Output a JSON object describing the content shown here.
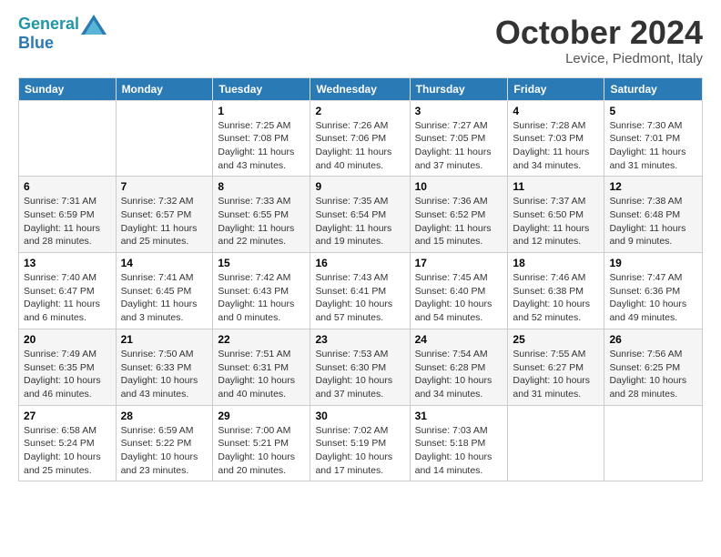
{
  "header": {
    "logo_line1": "General",
    "logo_line2": "Blue",
    "title": "October 2024",
    "location": "Levice, Piedmont, Italy"
  },
  "days_of_week": [
    "Sunday",
    "Monday",
    "Tuesday",
    "Wednesday",
    "Thursday",
    "Friday",
    "Saturday"
  ],
  "weeks": [
    [
      {
        "day": "",
        "info": ""
      },
      {
        "day": "",
        "info": ""
      },
      {
        "day": "1",
        "info": "Sunrise: 7:25 AM\nSunset: 7:08 PM\nDaylight: 11 hours and 43 minutes."
      },
      {
        "day": "2",
        "info": "Sunrise: 7:26 AM\nSunset: 7:06 PM\nDaylight: 11 hours and 40 minutes."
      },
      {
        "day": "3",
        "info": "Sunrise: 7:27 AM\nSunset: 7:05 PM\nDaylight: 11 hours and 37 minutes."
      },
      {
        "day": "4",
        "info": "Sunrise: 7:28 AM\nSunset: 7:03 PM\nDaylight: 11 hours and 34 minutes."
      },
      {
        "day": "5",
        "info": "Sunrise: 7:30 AM\nSunset: 7:01 PM\nDaylight: 11 hours and 31 minutes."
      }
    ],
    [
      {
        "day": "6",
        "info": "Sunrise: 7:31 AM\nSunset: 6:59 PM\nDaylight: 11 hours and 28 minutes."
      },
      {
        "day": "7",
        "info": "Sunrise: 7:32 AM\nSunset: 6:57 PM\nDaylight: 11 hours and 25 minutes."
      },
      {
        "day": "8",
        "info": "Sunrise: 7:33 AM\nSunset: 6:55 PM\nDaylight: 11 hours and 22 minutes."
      },
      {
        "day": "9",
        "info": "Sunrise: 7:35 AM\nSunset: 6:54 PM\nDaylight: 11 hours and 19 minutes."
      },
      {
        "day": "10",
        "info": "Sunrise: 7:36 AM\nSunset: 6:52 PM\nDaylight: 11 hours and 15 minutes."
      },
      {
        "day": "11",
        "info": "Sunrise: 7:37 AM\nSunset: 6:50 PM\nDaylight: 11 hours and 12 minutes."
      },
      {
        "day": "12",
        "info": "Sunrise: 7:38 AM\nSunset: 6:48 PM\nDaylight: 11 hours and 9 minutes."
      }
    ],
    [
      {
        "day": "13",
        "info": "Sunrise: 7:40 AM\nSunset: 6:47 PM\nDaylight: 11 hours and 6 minutes."
      },
      {
        "day": "14",
        "info": "Sunrise: 7:41 AM\nSunset: 6:45 PM\nDaylight: 11 hours and 3 minutes."
      },
      {
        "day": "15",
        "info": "Sunrise: 7:42 AM\nSunset: 6:43 PM\nDaylight: 11 hours and 0 minutes."
      },
      {
        "day": "16",
        "info": "Sunrise: 7:43 AM\nSunset: 6:41 PM\nDaylight: 10 hours and 57 minutes."
      },
      {
        "day": "17",
        "info": "Sunrise: 7:45 AM\nSunset: 6:40 PM\nDaylight: 10 hours and 54 minutes."
      },
      {
        "day": "18",
        "info": "Sunrise: 7:46 AM\nSunset: 6:38 PM\nDaylight: 10 hours and 52 minutes."
      },
      {
        "day": "19",
        "info": "Sunrise: 7:47 AM\nSunset: 6:36 PM\nDaylight: 10 hours and 49 minutes."
      }
    ],
    [
      {
        "day": "20",
        "info": "Sunrise: 7:49 AM\nSunset: 6:35 PM\nDaylight: 10 hours and 46 minutes."
      },
      {
        "day": "21",
        "info": "Sunrise: 7:50 AM\nSunset: 6:33 PM\nDaylight: 10 hours and 43 minutes."
      },
      {
        "day": "22",
        "info": "Sunrise: 7:51 AM\nSunset: 6:31 PM\nDaylight: 10 hours and 40 minutes."
      },
      {
        "day": "23",
        "info": "Sunrise: 7:53 AM\nSunset: 6:30 PM\nDaylight: 10 hours and 37 minutes."
      },
      {
        "day": "24",
        "info": "Sunrise: 7:54 AM\nSunset: 6:28 PM\nDaylight: 10 hours and 34 minutes."
      },
      {
        "day": "25",
        "info": "Sunrise: 7:55 AM\nSunset: 6:27 PM\nDaylight: 10 hours and 31 minutes."
      },
      {
        "day": "26",
        "info": "Sunrise: 7:56 AM\nSunset: 6:25 PM\nDaylight: 10 hours and 28 minutes."
      }
    ],
    [
      {
        "day": "27",
        "info": "Sunrise: 6:58 AM\nSunset: 5:24 PM\nDaylight: 10 hours and 25 minutes."
      },
      {
        "day": "28",
        "info": "Sunrise: 6:59 AM\nSunset: 5:22 PM\nDaylight: 10 hours and 23 minutes."
      },
      {
        "day": "29",
        "info": "Sunrise: 7:00 AM\nSunset: 5:21 PM\nDaylight: 10 hours and 20 minutes."
      },
      {
        "day": "30",
        "info": "Sunrise: 7:02 AM\nSunset: 5:19 PM\nDaylight: 10 hours and 17 minutes."
      },
      {
        "day": "31",
        "info": "Sunrise: 7:03 AM\nSunset: 5:18 PM\nDaylight: 10 hours and 14 minutes."
      },
      {
        "day": "",
        "info": ""
      },
      {
        "day": "",
        "info": ""
      }
    ]
  ]
}
